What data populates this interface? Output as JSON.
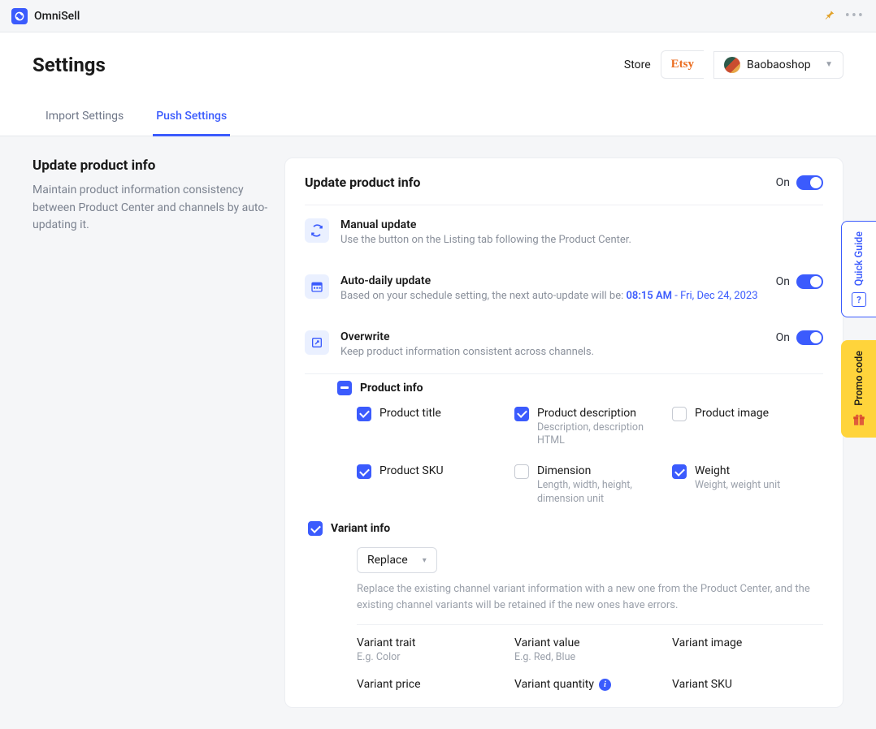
{
  "app": {
    "name": "OmniSell"
  },
  "topbar_icons": {
    "pin": "pin",
    "more": "more"
  },
  "header": {
    "title": "Settings",
    "store_label": "Store",
    "platform": "Etsy",
    "store_name": "Baobaoshop"
  },
  "tabs": [
    {
      "id": "import",
      "label": "Import Settings",
      "active": false
    },
    {
      "id": "push",
      "label": "Push Settings",
      "active": true
    }
  ],
  "left": {
    "title": "Update product info",
    "desc": "Maintain product information consistency between Product Center and channels by auto-updating it."
  },
  "card": {
    "title": "Update product info",
    "main_toggle_label": "On",
    "sections": {
      "manual": {
        "title": "Manual update",
        "desc": "Use the button on the Listing tab following the Product Center."
      },
      "auto": {
        "title": "Auto-daily update",
        "desc_prefix": "Based on your schedule setting, the next auto-update will be: ",
        "time": "08:15 AM",
        "separator": " - ",
        "date": "Fri, Dec 24, 2023",
        "toggle_label": "On"
      },
      "overwrite": {
        "title": "Overwrite",
        "desc": "Keep product information consistent across channels.",
        "toggle_label": "On"
      }
    },
    "product_info": {
      "group_label": "Product info",
      "fields": {
        "title": {
          "label": "Product title",
          "checked": true
        },
        "desc": {
          "label": "Product description",
          "sub": "Description, description HTML",
          "checked": true
        },
        "image": {
          "label": "Product image",
          "checked": false
        },
        "sku": {
          "label": "Product SKU",
          "checked": true
        },
        "dim": {
          "label": "Dimension",
          "sub": "Length, width, height, dimension unit",
          "checked": false
        },
        "weight": {
          "label": "Weight",
          "sub": "Weight, weight unit",
          "checked": true
        }
      }
    },
    "variant_info": {
      "group_label": "Variant info",
      "select_value": "Replace",
      "note": "Replace the existing channel variant information with a new one from the Product Center, and the existing channel variants will be retained if the new ones have errors.",
      "fields": {
        "trait": {
          "label": "Variant trait",
          "eg": "E.g. Color"
        },
        "value": {
          "label": "Variant value",
          "eg": "E.g. Red, Blue"
        },
        "image": {
          "label": "Variant image"
        },
        "price": {
          "label": "Variant price"
        },
        "quantity": {
          "label": "Variant quantity"
        },
        "sku": {
          "label": "Variant SKU"
        }
      }
    }
  },
  "side": {
    "guide": "Quick Guide",
    "promo": "Promo code"
  }
}
